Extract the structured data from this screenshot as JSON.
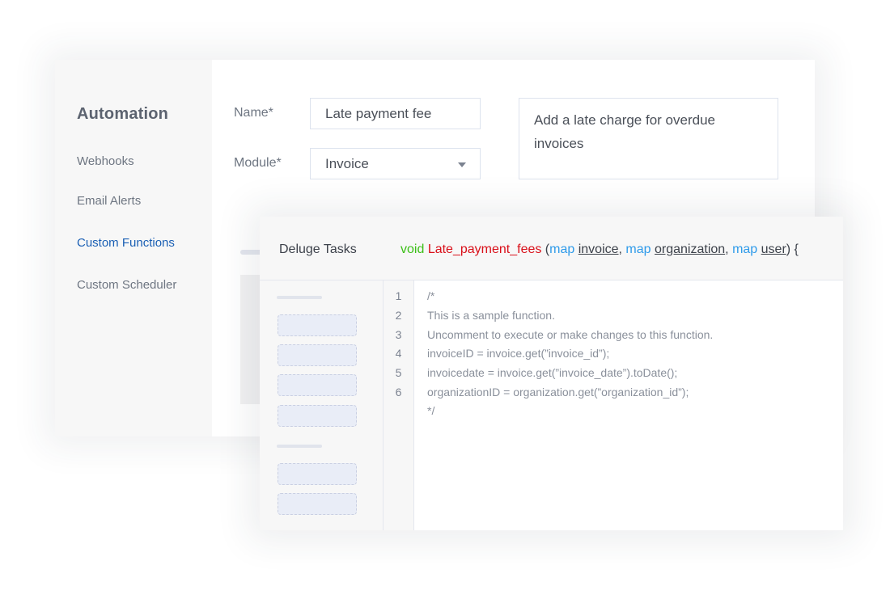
{
  "sidebar": {
    "title": "Automation",
    "items": [
      {
        "label": "Webhooks",
        "active": false
      },
      {
        "label": "Email Alerts",
        "active": false
      },
      {
        "label": "Custom Functions",
        "active": true
      },
      {
        "label": "Custom Scheduler",
        "active": false
      }
    ]
  },
  "form": {
    "name_label": "Name*",
    "name_value": "Late payment fee",
    "module_label": "Module*",
    "module_value": "Invoice",
    "description_value": "Add a late charge for overdue invoices"
  },
  "editor": {
    "header_title": "Deluge Tasks",
    "signature": {
      "return_type": "void",
      "function_name": "Late_payment_fees",
      "open_paren": " (",
      "params": [
        {
          "type": "map",
          "name": "invoice"
        },
        {
          "type": "map",
          "name": "organization"
        },
        {
          "type": "map",
          "name": "user"
        }
      ],
      "separator": ", ",
      "close": ") {"
    },
    "line_numbers": [
      "1",
      "2",
      "3",
      "4",
      "5",
      "6"
    ],
    "code_lines": [
      "/*",
      "This is a sample function.",
      "Uncomment to execute or make changes to this function.",
      "invoiceID = invoice.get(”invoice_id”);",
      "invoicedate = invoice.get(”invoice_date”).toDate();",
      "organizationID = organization.get(”organization_id”);",
      "*/"
    ]
  },
  "colors": {
    "active_nav": "#1a5fb4",
    "keyword_void": "#3bbf17",
    "function_name": "#d9101a",
    "keyword_map": "#2f9bea"
  }
}
